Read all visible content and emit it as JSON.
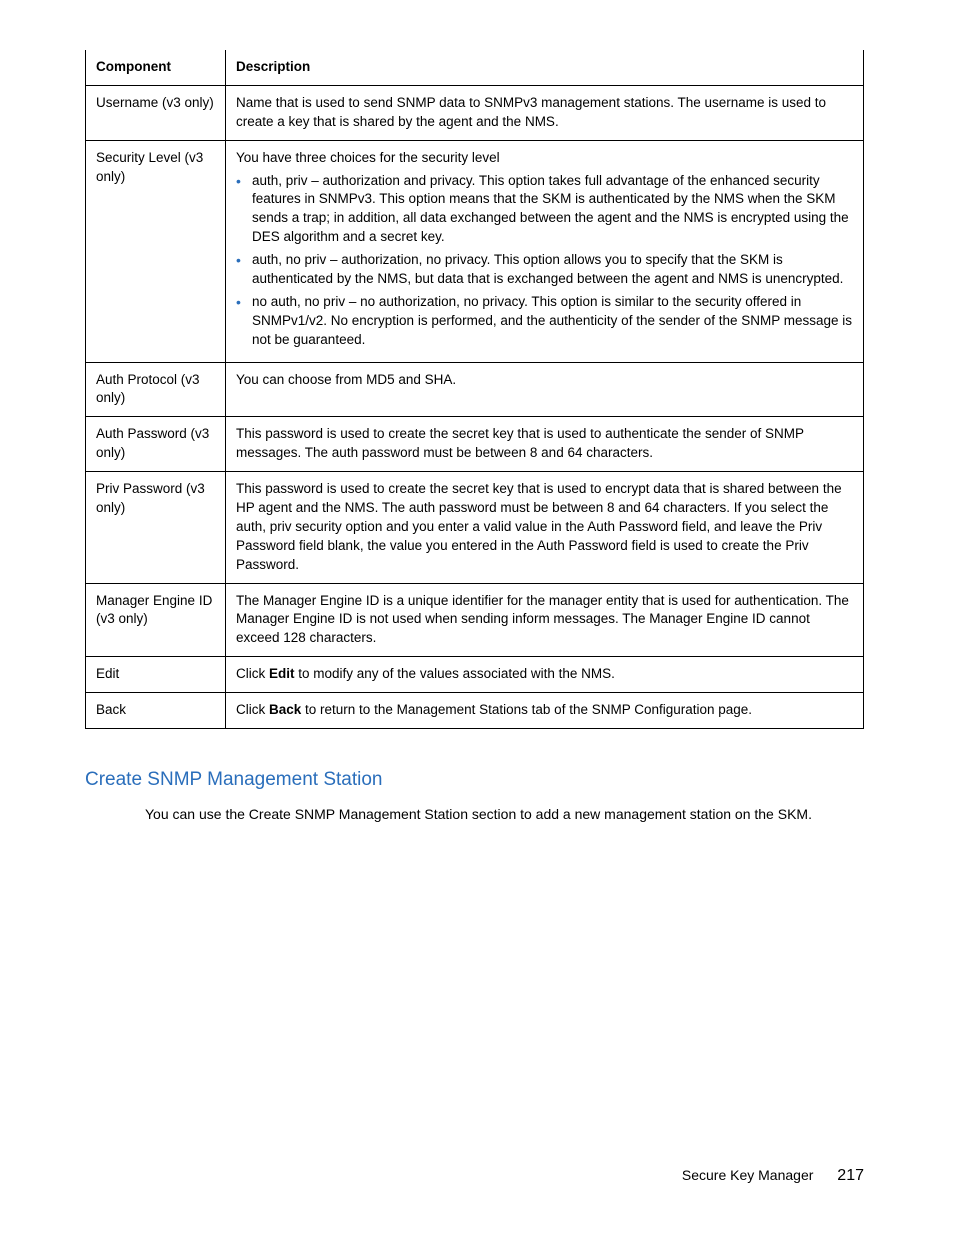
{
  "table": {
    "headers": {
      "component": "Component",
      "description": "Description"
    },
    "rows": {
      "username": {
        "component": "Username (v3 only)",
        "desc": "Name that is used to send SNMP data to SNMPv3 management stations. The username is used to create a key that is shared by the agent and the NMS."
      },
      "seclevel": {
        "component": "Security Level (v3 only)",
        "intro": "You have three choices for the security level",
        "b1": "auth, priv – authorization and privacy. This option takes full advantage of the enhanced security features in SNMPv3. This option means that the SKM is authenticated by the NMS when the SKM sends a trap; in addition, all data exchanged between the agent and the NMS is encrypted using the DES algorithm and a secret key.",
        "b2": "auth, no priv – authorization, no privacy. This option allows you to specify that the SKM is authenticated by the NMS, but data that is exchanged between the agent and NMS is unencrypted.",
        "b3": "no auth, no priv – no authorization, no privacy. This option is similar to the security offered in SNMPv1/v2. No encryption is performed, and the authenticity of the sender of the SNMP message is not be guaranteed."
      },
      "authproto": {
        "component": "Auth Protocol (v3 only)",
        "desc": "You can choose from MD5 and SHA."
      },
      "authpass": {
        "component": "Auth Password (v3 only)",
        "desc": "This password is used to create the secret key that is used to authenticate the sender of SNMP messages. The auth password must be between 8 and 64 characters."
      },
      "privpass": {
        "component": "Priv Password (v3 only)",
        "desc": "This password is used to create the secret key that is used to encrypt data that is shared between the HP agent and the NMS. The auth password must be between 8 and 64 characters. If you select the auth, priv security option and you enter a valid value in the Auth Password field, and leave the Priv Password field blank, the value you entered in the Auth Password field is used to create the Priv Password."
      },
      "engine": {
        "component": "Manager Engine ID (v3 only)",
        "desc": "The Manager Engine ID is a unique identifier for the manager entity that is used for authentication. The Manager Engine ID is not used when sending inform messages. The Manager Engine ID cannot exceed 128 characters."
      },
      "edit": {
        "component": "Edit",
        "pre": "Click ",
        "bold": "Edit",
        "post": " to modify any of the values associated with the NMS."
      },
      "back": {
        "component": "Back",
        "pre": "Click ",
        "bold": "Back",
        "post": " to return to the Management Stations tab of the SNMP Configuration page."
      }
    }
  },
  "section": {
    "heading": "Create SNMP Management Station",
    "body": "You can use the Create SNMP Management Station section to add a new management station on the SKM."
  },
  "footer": {
    "title": "Secure Key Manager",
    "page": "217"
  }
}
